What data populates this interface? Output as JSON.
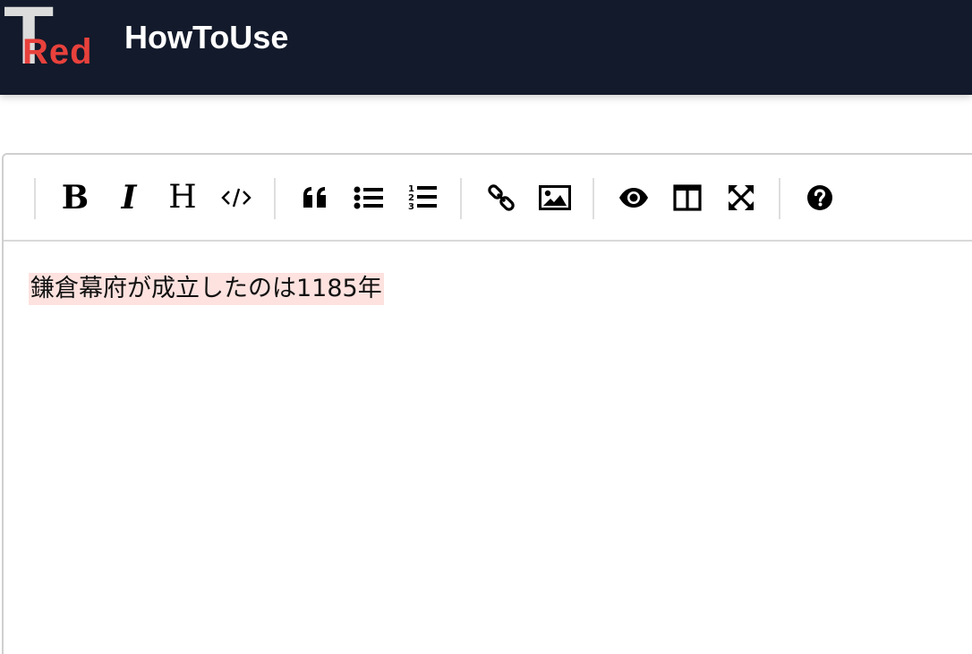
{
  "header": {
    "logo_t": "T",
    "logo_red": "Red",
    "title": "HowToUse",
    "background_color": "#121a2b",
    "logo_accent_color": "#e8413c"
  },
  "editor": {
    "toolbar": [
      {
        "name": "bold",
        "label": "B",
        "icon": "bold-icon"
      },
      {
        "name": "italic",
        "label": "I",
        "icon": "italic-icon"
      },
      {
        "name": "heading",
        "label": "H",
        "icon": "heading-icon"
      },
      {
        "name": "code",
        "icon": "code-icon"
      },
      {
        "name": "quote",
        "icon": "quote-icon"
      },
      {
        "name": "unordered-list",
        "icon": "unordered-list-icon"
      },
      {
        "name": "ordered-list",
        "icon": "ordered-list-icon"
      },
      {
        "name": "link",
        "icon": "link-icon"
      },
      {
        "name": "image",
        "icon": "image-icon"
      },
      {
        "name": "preview",
        "icon": "eye-icon"
      },
      {
        "name": "side-by-side",
        "icon": "columns-icon"
      },
      {
        "name": "fullscreen",
        "icon": "fullscreen-icon"
      },
      {
        "name": "guide",
        "icon": "question-circle-icon"
      }
    ],
    "content": "鎌倉幕府が成立したのは1185年",
    "highlight_color": "#fde2df"
  }
}
